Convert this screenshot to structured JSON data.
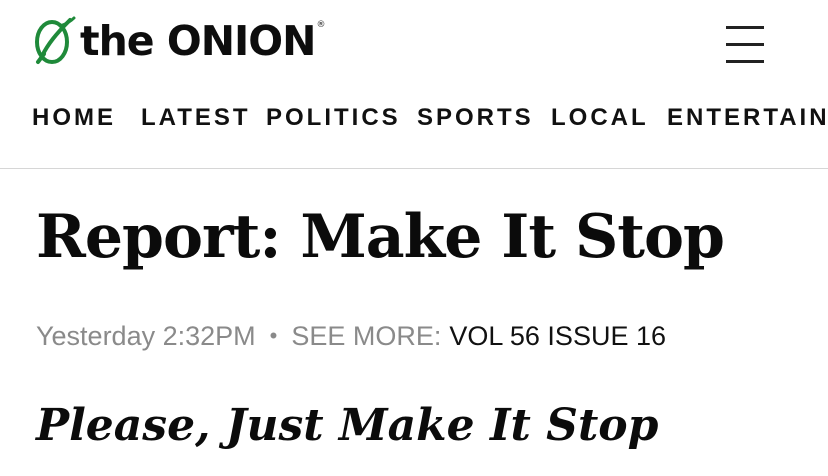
{
  "brand": {
    "name": "the ONION",
    "registered": "®",
    "accent_color": "#1f8a3a"
  },
  "header": {
    "menu_icon": "hamburger-menu-icon"
  },
  "nav": {
    "items": [
      {
        "label": "HOME"
      },
      {
        "label": "LATEST"
      },
      {
        "label": "POLITICS"
      },
      {
        "label": "SPORTS"
      },
      {
        "label": "LOCAL"
      },
      {
        "label": "ENTERTAINM"
      }
    ]
  },
  "article": {
    "headline": "Report: Make It Stop",
    "timestamp": "Yesterday 2:32PM",
    "separator": "•",
    "see_more_label": "SEE MORE:",
    "issue_link": "VOL 56 ISSUE 16",
    "subheadline": "Please, Just Make It Stop"
  }
}
